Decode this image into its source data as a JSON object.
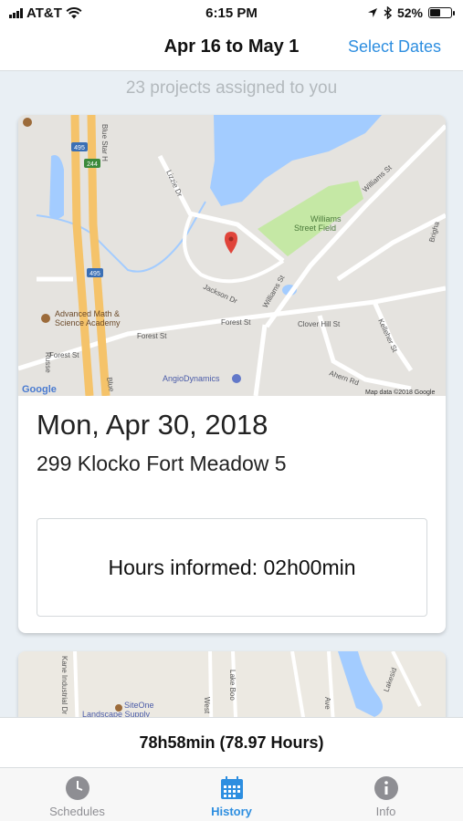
{
  "status_bar": {
    "carrier": "AT&T",
    "time": "6:15 PM",
    "battery": "52%",
    "battery_level": 0.52
  },
  "nav": {
    "title": "Apr 16 to May 1",
    "select_dates_label": "Select Dates"
  },
  "assigned_text": "23 projects assigned to you",
  "projects": [
    {
      "date": "Mon, Apr 30, 2018",
      "address": "299 Klocko Fort Meadow 5",
      "hours": "Hours informed: 02h00min",
      "map": {
        "labels": {
          "williams_field": "Williams",
          "williams_field_2": "Street Field",
          "williams_st": "Williams St",
          "williams_st_2": "Williams St",
          "lizzie_dr": "Lizzie Dr",
          "jackson_dr": "Jackson Dr",
          "forest_st_1": "Forest St",
          "forest_st_2": "Forest St",
          "forest_st_3": "Forest St",
          "clover_hill_st": "Clover Hill St",
          "kelleher_st": "Kelleher St",
          "ahern_rd": "Ahern Rd",
          "academy_1": "Advanced Math &",
          "academy_2": "Science Academy",
          "angiodynamics": "AngioDynamics",
          "blue_star_1": "Blue Star H",
          "blue_star_2": "Blue",
          "route_495_a": "495",
          "route_495_b": "495",
          "route_244": "244",
          "brigham": "Brigha",
          "russell": "Russe",
          "google": "Google",
          "map_data": "Map data ©2018 Google"
        }
      }
    },
    {
      "map": {
        "labels": {
          "kane_industrial": "Kane Industrial Dr",
          "siteone_1": "SiteOne",
          "siteone_2": "Landscape Supply",
          "west": "West",
          "lake_boon": "Lake Boo",
          "ave": "Ave",
          "lakeside": "Lakesid"
        }
      }
    }
  ],
  "totals": "78h58min (78.97 Hours)",
  "tabs": [
    {
      "label": "Schedules",
      "icon": "clock-icon",
      "active": false
    },
    {
      "label": "History",
      "icon": "calendar-icon",
      "active": true
    },
    {
      "label": "Info",
      "icon": "info-icon",
      "active": false
    }
  ],
  "colors": {
    "accent": "#2d8ee0",
    "map_water": "#a3ccff",
    "map_park": "#c5e8a5",
    "highway": "#f5c36a",
    "pin": "#e0443a"
  }
}
